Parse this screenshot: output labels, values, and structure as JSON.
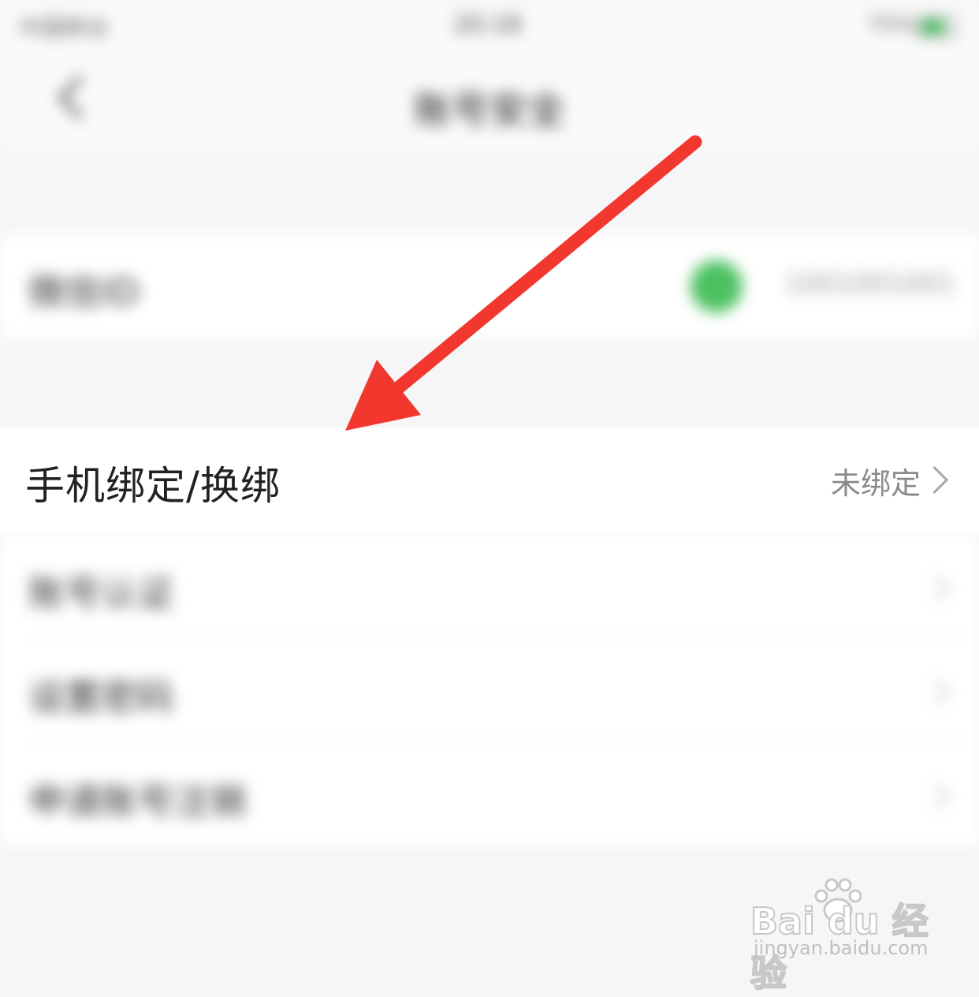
{
  "status_bar": {
    "carrier": "中国移动",
    "time": "20:18",
    "battery": "75%",
    "battery_level": 0.75
  },
  "nav": {
    "title": "账号安全"
  },
  "rows": {
    "wechat_id": {
      "label": "微信ID",
      "value": "1001001001"
    },
    "phone_binding": {
      "label": "手机绑定/换绑",
      "status": "未绑定"
    },
    "account_auth": {
      "label": "账号认证"
    },
    "set_password": {
      "label": "设置密码"
    },
    "apply_cancel": {
      "label": "申请账号注销"
    }
  },
  "annotation": {
    "color": "#f2382e"
  },
  "watermark": {
    "brand": "Bai du 经验",
    "url": "jingyan.baidu.com"
  }
}
